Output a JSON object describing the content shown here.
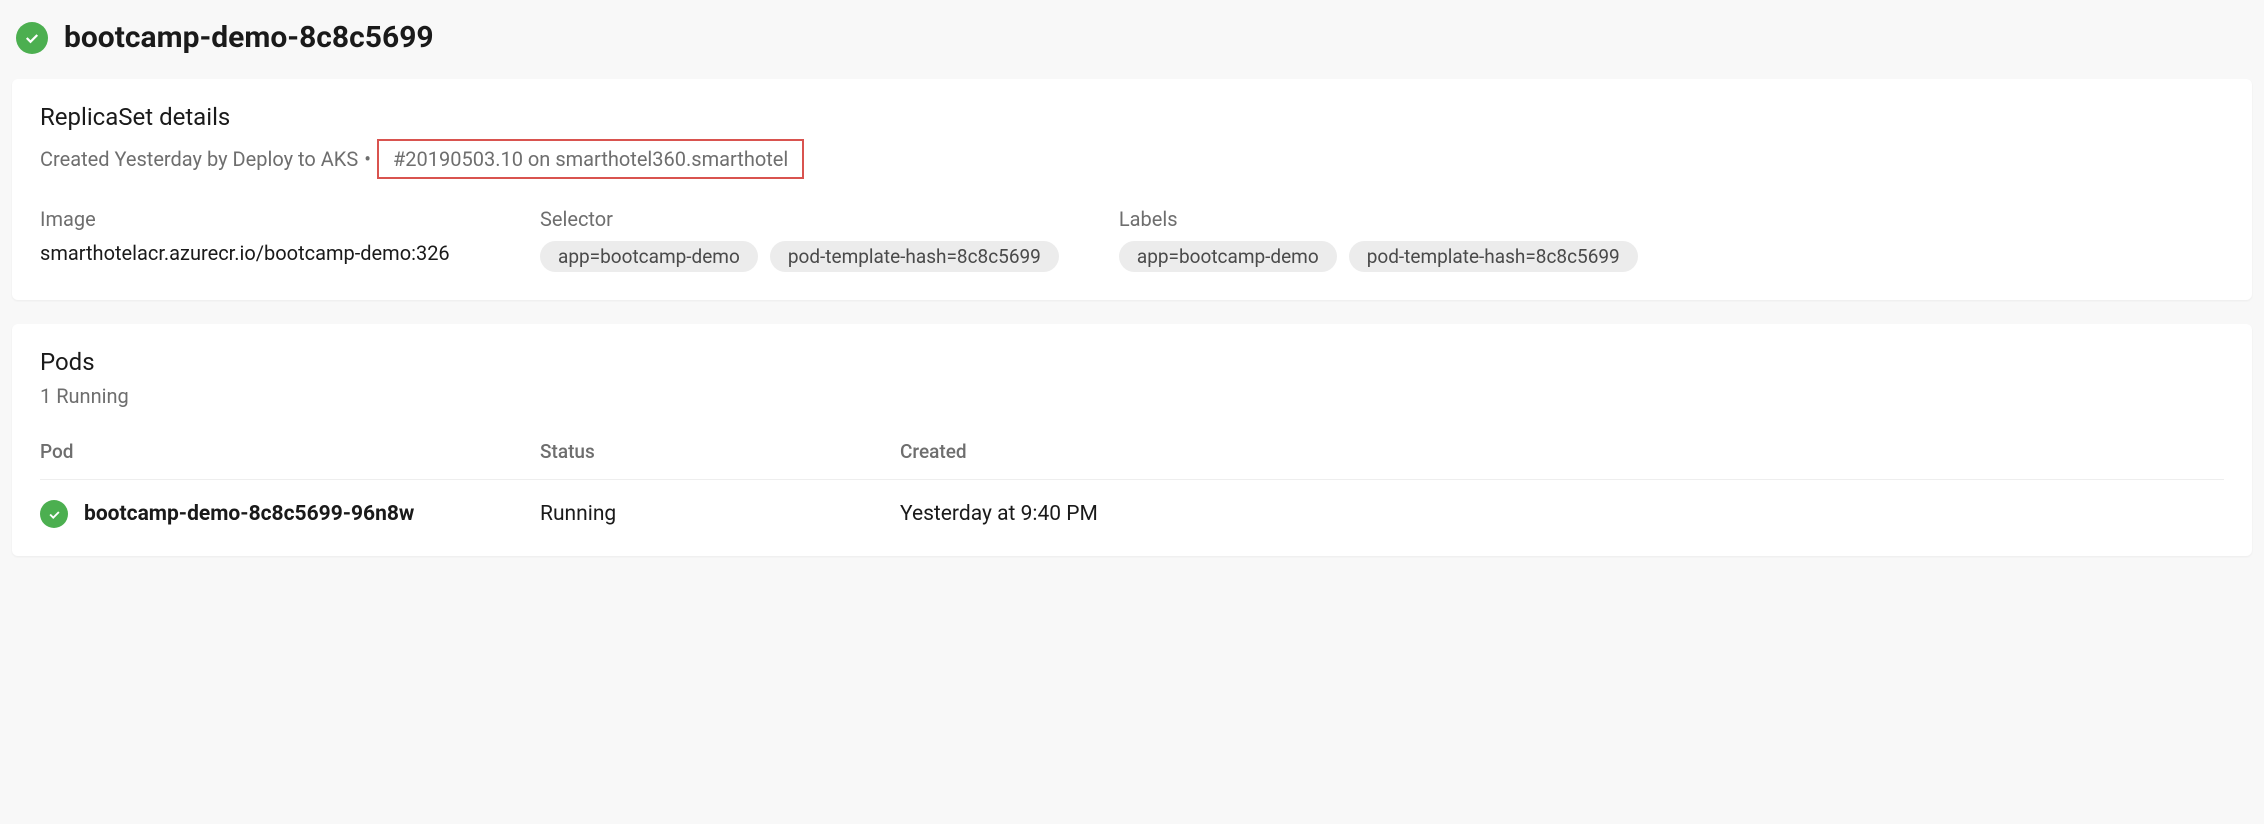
{
  "header": {
    "title": "bootcamp-demo-8c8c5699"
  },
  "details": {
    "section_title": "ReplicaSet details",
    "created_prefix": "Created Yesterday by Deploy to AKS",
    "separator": "•",
    "build_link": "#20190503.10 on smarthotel360.smarthotel",
    "image_label": "Image",
    "image_value": "smarthotelacr.azurecr.io/bootcamp-demo:326",
    "selector_label": "Selector",
    "selector_pills": [
      "app=bootcamp-demo",
      "pod-template-hash=8c8c5699"
    ],
    "labels_label": "Labels",
    "labels_pills": [
      "app=bootcamp-demo",
      "pod-template-hash=8c8c5699"
    ]
  },
  "pods": {
    "section_title": "Pods",
    "subtitle": "1 Running",
    "columns": {
      "pod": "Pod",
      "status": "Status",
      "created": "Created"
    },
    "rows": [
      {
        "name": "bootcamp-demo-8c8c5699-96n8w",
        "status": "Running",
        "created": "Yesterday at 9:40 PM"
      }
    ]
  }
}
